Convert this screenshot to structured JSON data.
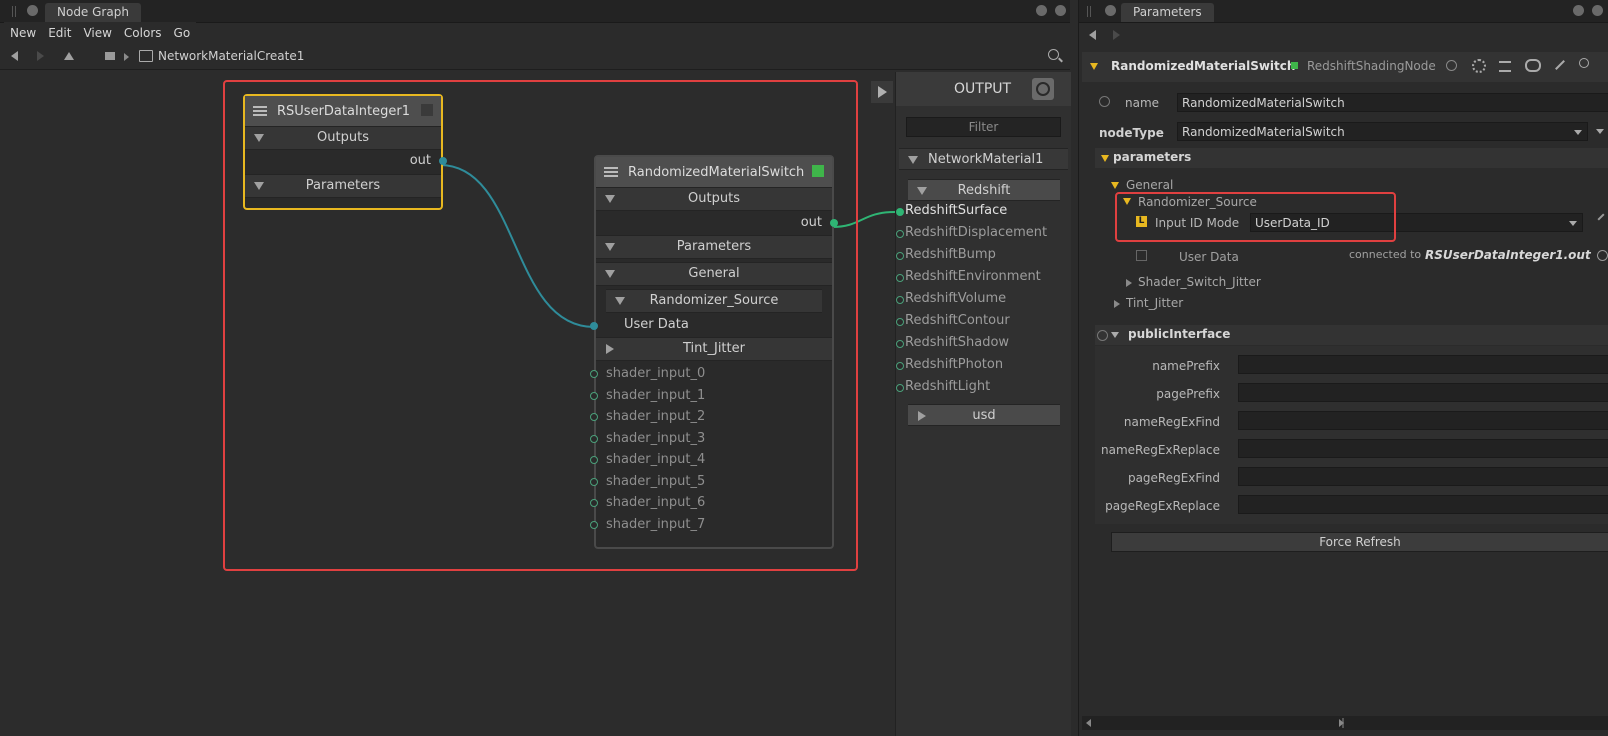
{
  "left_panel": {
    "tab": "Node Graph",
    "menu": [
      "New",
      "Edit",
      "View",
      "Colors",
      "Go"
    ],
    "breadcrumb": "NetworkMaterialCreate1"
  },
  "nodes": {
    "user_data": {
      "title": "RSUserDataInteger1",
      "outputs_label": "Outputs",
      "out_label": "out",
      "parameters_label": "Parameters"
    },
    "switch": {
      "title": "RandomizedMaterialSwitch",
      "outputs_label": "Outputs",
      "out_label": "out",
      "parameters_label": "Parameters",
      "general_label": "General",
      "randomizer_label": "Randomizer_Source",
      "user_data_label": "User Data",
      "tint_label": "Tint_Jitter",
      "inputs": [
        "shader_input_0",
        "shader_input_1",
        "shader_input_2",
        "shader_input_3",
        "shader_input_4",
        "shader_input_5",
        "shader_input_6",
        "shader_input_7"
      ]
    }
  },
  "output_panel": {
    "title": "OUTPUT",
    "filter_placeholder": "Filter",
    "network_label": "NetworkMaterial1",
    "redshift_label": "Redshift",
    "ports": [
      "RedshiftSurface",
      "RedshiftDisplacement",
      "RedshiftBump",
      "RedshiftEnvironment",
      "RedshiftVolume",
      "RedshiftContour",
      "RedshiftShadow",
      "RedshiftPhoton",
      "RedshiftLight"
    ],
    "usd_label": "usd"
  },
  "parameters_panel": {
    "tab": "Parameters",
    "node_name": "RandomizedMaterialSwitch",
    "node_type_label": "RedshiftShadingNode",
    "name_label": "name",
    "name_value": "RandomizedMaterialSwitch",
    "nodetype_label": "nodeType",
    "nodetype_value": "RandomizedMaterialSwitch",
    "parameters_group": "parameters",
    "general_group": "General",
    "randomizer_group": "Randomizer_Source",
    "input_id_mode_label": "Input ID Mode",
    "input_id_mode_value": "UserData_ID",
    "user_data_label": "User Data",
    "connected_prefix": "connected to",
    "connected_target": "RSUserDataInteger1.out",
    "shader_switch_jitter": "Shader_Switch_Jitter",
    "tint_jitter": "Tint_Jitter",
    "public_interface": "publicInterface",
    "fields": [
      {
        "label": "namePrefix",
        "value": ""
      },
      {
        "label": "pagePrefix",
        "value": ""
      },
      {
        "label": "nameRegExFind",
        "value": ""
      },
      {
        "label": "nameRegExReplace",
        "value": ""
      },
      {
        "label": "pageRegExFind",
        "value": ""
      },
      {
        "label": "pageRegExReplace",
        "value": ""
      }
    ],
    "force_refresh": "Force Refresh"
  },
  "colors": {
    "highlight_red": "#e04040",
    "selected_yellow": "#e8b820",
    "wire_teal": "#2f8c9a",
    "port_green": "#2fb574"
  }
}
